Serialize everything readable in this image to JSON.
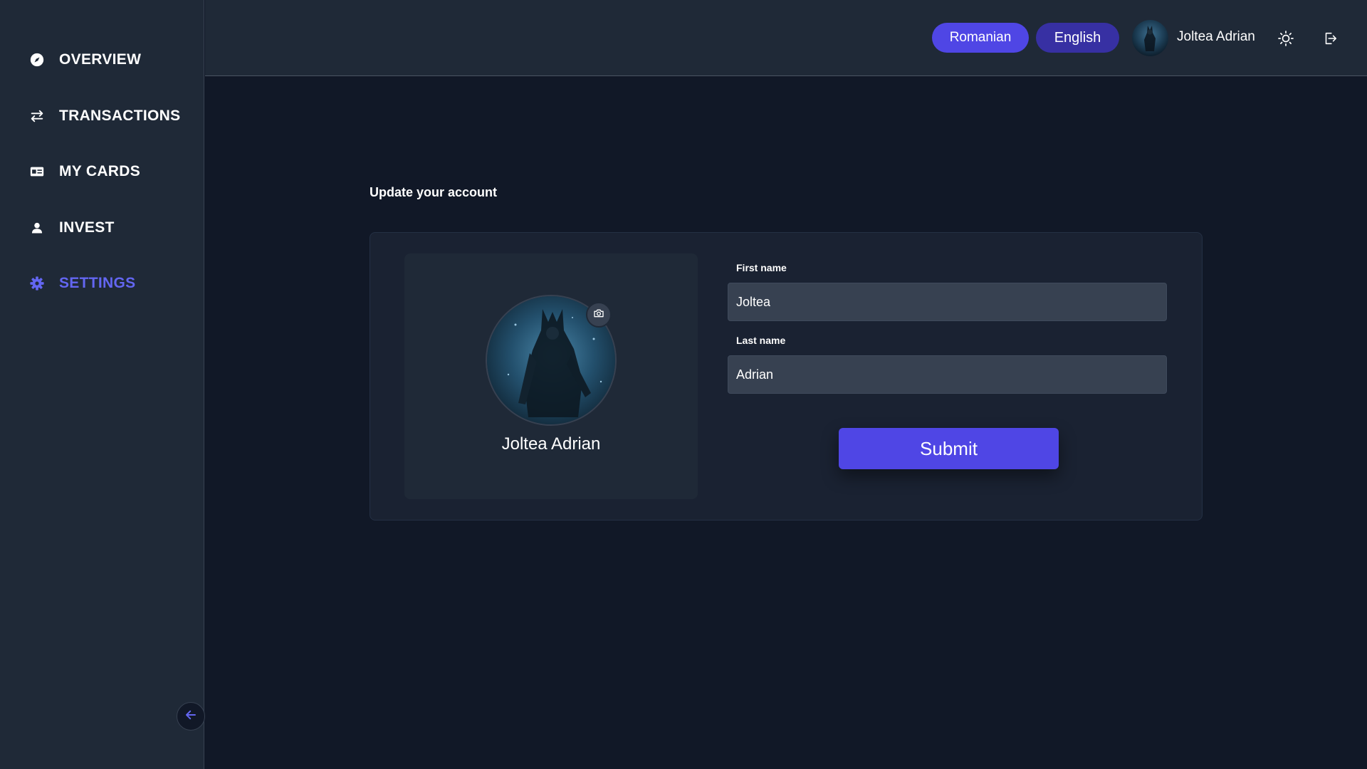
{
  "sidebar": {
    "items": [
      {
        "label": "OVERVIEW",
        "icon": "compass-icon",
        "active": false
      },
      {
        "label": "TRANSACTIONS",
        "icon": "arrows-swap-icon",
        "active": false
      },
      {
        "label": "MY CARDS",
        "icon": "card-icon",
        "active": false
      },
      {
        "label": "INVEST",
        "icon": "user-icon",
        "active": false
      },
      {
        "label": "SETTINGS",
        "icon": "gear-icon",
        "active": true
      }
    ],
    "collapse_icon": "arrow-left-icon"
  },
  "header": {
    "lang_romanian": "Romanian",
    "lang_english": "English",
    "user_name": "Joltea Adrian",
    "theme_icon": "sun-icon",
    "logout_icon": "logout-icon"
  },
  "main": {
    "title": "Update your account",
    "profile": {
      "name": "Joltea Adrian",
      "camera_icon": "camera-icon"
    },
    "form": {
      "first_name_label": "First name",
      "first_name_value": "Joltea",
      "last_name_label": "Last name",
      "last_name_value": "Adrian",
      "submit_label": "Submit"
    }
  },
  "colors": {
    "accent": "#4f46e5",
    "accent_active_text": "#6366f1",
    "english_button": "#3730a3",
    "sidebar_bg": "#1f2937",
    "page_bg": "#111827",
    "input_bg": "#374151"
  }
}
